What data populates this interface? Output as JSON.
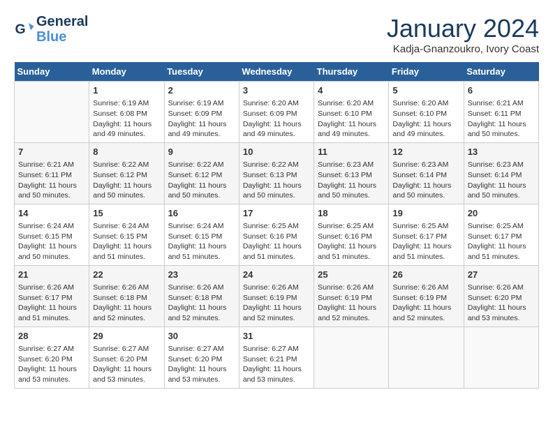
{
  "header": {
    "logo_line1": "General",
    "logo_line2": "Blue",
    "month_title": "January 2024",
    "subtitle": "Kadja-Gnanzoukro, Ivory Coast"
  },
  "calendar": {
    "days_of_week": [
      "Sunday",
      "Monday",
      "Tuesday",
      "Wednesday",
      "Thursday",
      "Friday",
      "Saturday"
    ],
    "weeks": [
      [
        {
          "day": "",
          "info": ""
        },
        {
          "day": "1",
          "info": "Sunrise: 6:19 AM\nSunset: 6:08 PM\nDaylight: 11 hours\nand 49 minutes."
        },
        {
          "day": "2",
          "info": "Sunrise: 6:19 AM\nSunset: 6:09 PM\nDaylight: 11 hours\nand 49 minutes."
        },
        {
          "day": "3",
          "info": "Sunrise: 6:20 AM\nSunset: 6:09 PM\nDaylight: 11 hours\nand 49 minutes."
        },
        {
          "day": "4",
          "info": "Sunrise: 6:20 AM\nSunset: 6:10 PM\nDaylight: 11 hours\nand 49 minutes."
        },
        {
          "day": "5",
          "info": "Sunrise: 6:20 AM\nSunset: 6:10 PM\nDaylight: 11 hours\nand 49 minutes."
        },
        {
          "day": "6",
          "info": "Sunrise: 6:21 AM\nSunset: 6:11 PM\nDaylight: 11 hours\nand 50 minutes."
        }
      ],
      [
        {
          "day": "7",
          "info": "Sunrise: 6:21 AM\nSunset: 6:11 PM\nDaylight: 11 hours\nand 50 minutes."
        },
        {
          "day": "8",
          "info": "Sunrise: 6:22 AM\nSunset: 6:12 PM\nDaylight: 11 hours\nand 50 minutes."
        },
        {
          "day": "9",
          "info": "Sunrise: 6:22 AM\nSunset: 6:12 PM\nDaylight: 11 hours\nand 50 minutes."
        },
        {
          "day": "10",
          "info": "Sunrise: 6:22 AM\nSunset: 6:13 PM\nDaylight: 11 hours\nand 50 minutes."
        },
        {
          "day": "11",
          "info": "Sunrise: 6:23 AM\nSunset: 6:13 PM\nDaylight: 11 hours\nand 50 minutes."
        },
        {
          "day": "12",
          "info": "Sunrise: 6:23 AM\nSunset: 6:14 PM\nDaylight: 11 hours\nand 50 minutes."
        },
        {
          "day": "13",
          "info": "Sunrise: 6:23 AM\nSunset: 6:14 PM\nDaylight: 11 hours\nand 50 minutes."
        }
      ],
      [
        {
          "day": "14",
          "info": "Sunrise: 6:24 AM\nSunset: 6:15 PM\nDaylight: 11 hours\nand 50 minutes."
        },
        {
          "day": "15",
          "info": "Sunrise: 6:24 AM\nSunset: 6:15 PM\nDaylight: 11 hours\nand 51 minutes."
        },
        {
          "day": "16",
          "info": "Sunrise: 6:24 AM\nSunset: 6:15 PM\nDaylight: 11 hours\nand 51 minutes."
        },
        {
          "day": "17",
          "info": "Sunrise: 6:25 AM\nSunset: 6:16 PM\nDaylight: 11 hours\nand 51 minutes."
        },
        {
          "day": "18",
          "info": "Sunrise: 6:25 AM\nSunset: 6:16 PM\nDaylight: 11 hours\nand 51 minutes."
        },
        {
          "day": "19",
          "info": "Sunrise: 6:25 AM\nSunset: 6:17 PM\nDaylight: 11 hours\nand 51 minutes."
        },
        {
          "day": "20",
          "info": "Sunrise: 6:25 AM\nSunset: 6:17 PM\nDaylight: 11 hours\nand 51 minutes."
        }
      ],
      [
        {
          "day": "21",
          "info": "Sunrise: 6:26 AM\nSunset: 6:17 PM\nDaylight: 11 hours\nand 51 minutes."
        },
        {
          "day": "22",
          "info": "Sunrise: 6:26 AM\nSunset: 6:18 PM\nDaylight: 11 hours\nand 52 minutes."
        },
        {
          "day": "23",
          "info": "Sunrise: 6:26 AM\nSunset: 6:18 PM\nDaylight: 11 hours\nand 52 minutes."
        },
        {
          "day": "24",
          "info": "Sunrise: 6:26 AM\nSunset: 6:19 PM\nDaylight: 11 hours\nand 52 minutes."
        },
        {
          "day": "25",
          "info": "Sunrise: 6:26 AM\nSunset: 6:19 PM\nDaylight: 11 hours\nand 52 minutes."
        },
        {
          "day": "26",
          "info": "Sunrise: 6:26 AM\nSunset: 6:19 PM\nDaylight: 11 hours\nand 52 minutes."
        },
        {
          "day": "27",
          "info": "Sunrise: 6:26 AM\nSunset: 6:20 PM\nDaylight: 11 hours\nand 53 minutes."
        }
      ],
      [
        {
          "day": "28",
          "info": "Sunrise: 6:27 AM\nSunset: 6:20 PM\nDaylight: 11 hours\nand 53 minutes."
        },
        {
          "day": "29",
          "info": "Sunrise: 6:27 AM\nSunset: 6:20 PM\nDaylight: 11 hours\nand 53 minutes."
        },
        {
          "day": "30",
          "info": "Sunrise: 6:27 AM\nSunset: 6:20 PM\nDaylight: 11 hours\nand 53 minutes."
        },
        {
          "day": "31",
          "info": "Sunrise: 6:27 AM\nSunset: 6:21 PM\nDaylight: 11 hours\nand 53 minutes."
        },
        {
          "day": "",
          "info": ""
        },
        {
          "day": "",
          "info": ""
        },
        {
          "day": "",
          "info": ""
        }
      ]
    ]
  }
}
